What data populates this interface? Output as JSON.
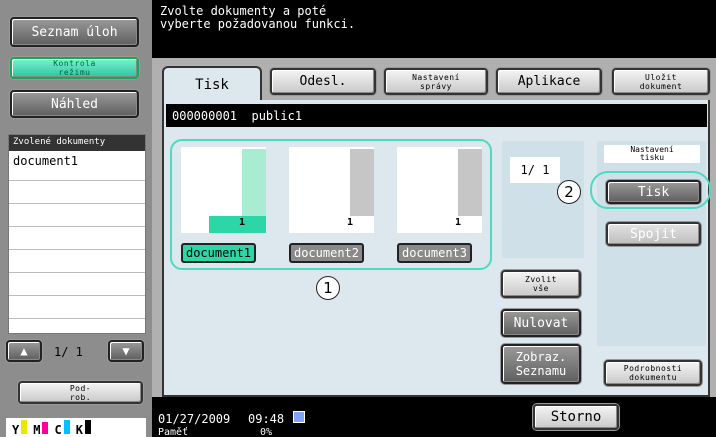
{
  "left": {
    "job_list": "Seznam úloh",
    "check_mode": "Kontrola režimu",
    "preview": "Náhled",
    "selected_header": "Zvolené dokumenty",
    "selected_items": [
      "document1"
    ],
    "pager": "1/ 1",
    "job_button": "Pod-rob.",
    "toner": [
      "Y",
      "M",
      "C",
      "K"
    ]
  },
  "header": {
    "instruction_line1": "Zvolte dokumenty a poté",
    "instruction_line2": "vyberte požadovanou funkci."
  },
  "tabs": [
    {
      "label": "Tisk",
      "active": true
    },
    {
      "label": "Odesl."
    },
    {
      "label": "Nastavení správy"
    },
    {
      "label": "Aplikace"
    },
    {
      "label": "Uložit dokument"
    }
  ],
  "box": {
    "id": "000000001",
    "name": "public1"
  },
  "documents": [
    {
      "name": "document1",
      "pages": "1",
      "selected": true
    },
    {
      "name": "document2",
      "pages": "1",
      "selected": false
    },
    {
      "name": "document3",
      "pages": "1",
      "selected": false
    }
  ],
  "doc_pager": "1/ 1",
  "actions": {
    "select_all": "Zvolit vše",
    "reset": "Nulovat",
    "list_view": "Zobraz. Seznamu"
  },
  "print_settings": {
    "title": "Nastavení tisku",
    "print": "Tisk",
    "combine": "Spojit",
    "details": "Podrobnosti dokumentu"
  },
  "callouts": [
    "1",
    "2"
  ],
  "status": {
    "date": "01/27/2009",
    "time": "09:48",
    "memory_label": "Paměť",
    "memory_value": "0%",
    "stop": "Storno"
  },
  "colors": {
    "accent": "#4fd9c2",
    "selected": "#2dc6a0"
  }
}
